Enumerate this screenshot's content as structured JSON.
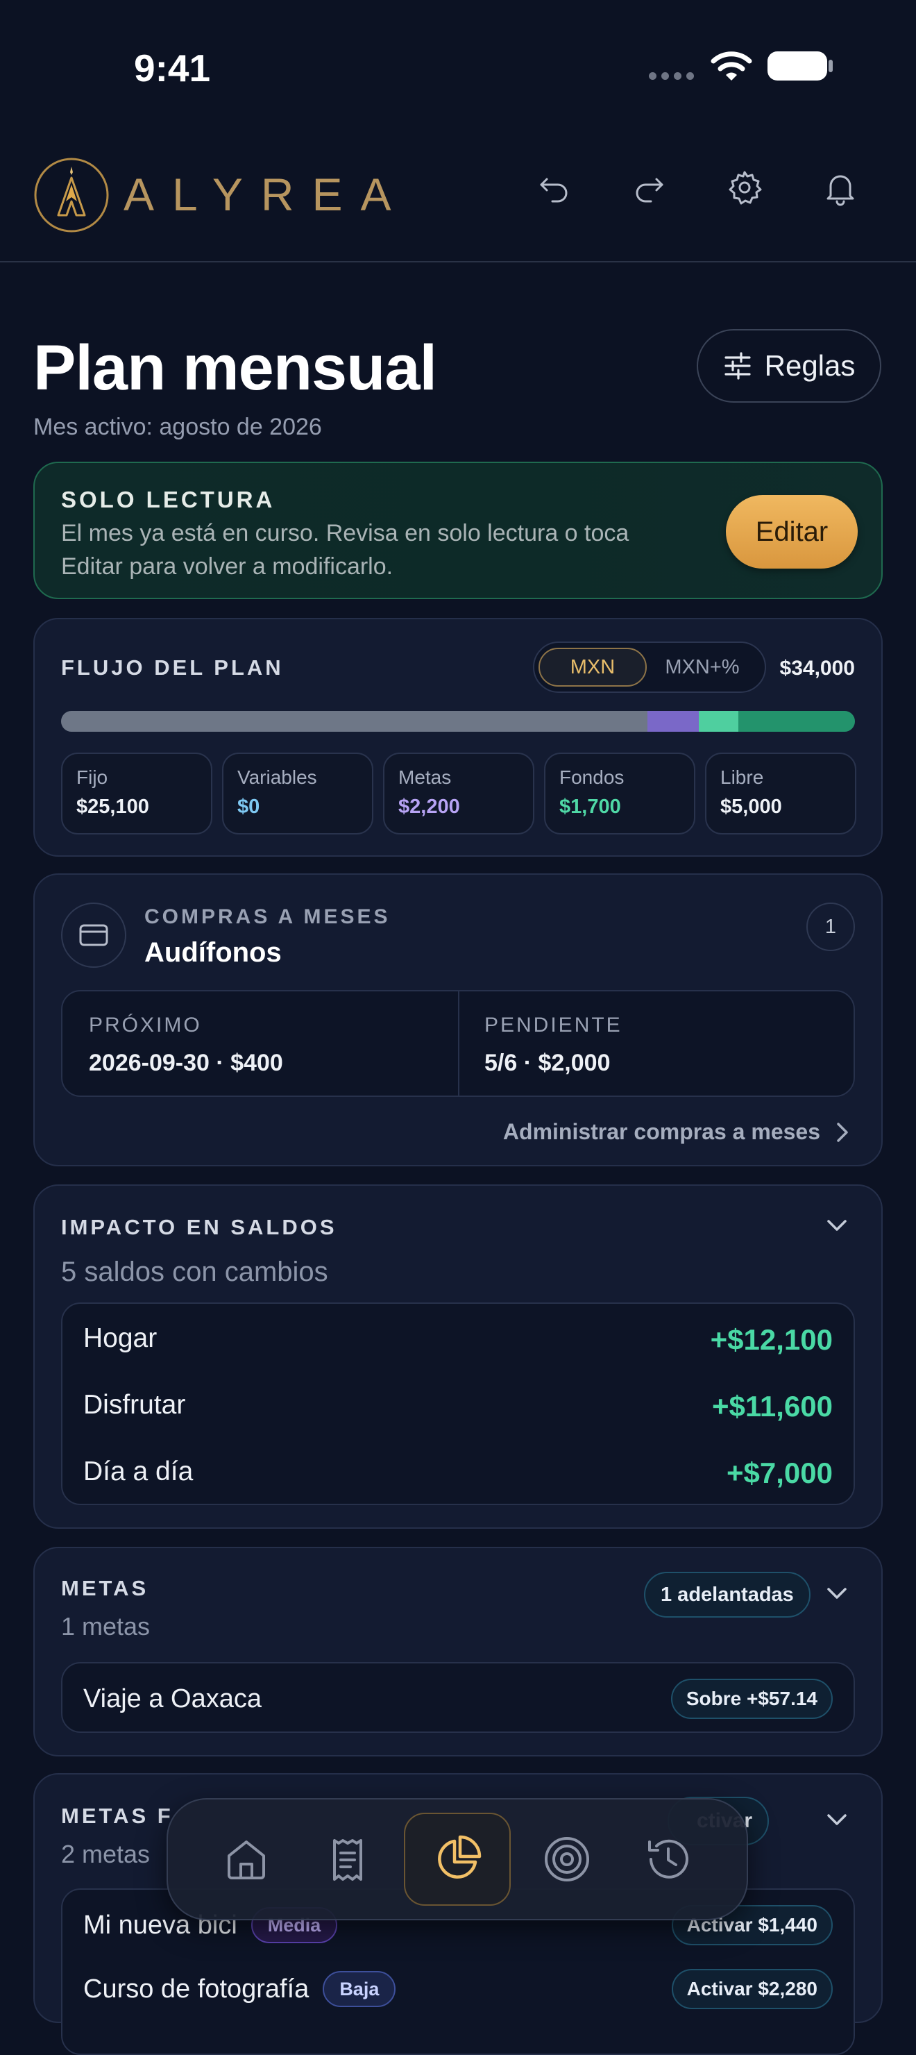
{
  "status_bar": {
    "time": "9:41"
  },
  "header": {
    "brand": "ALYREA",
    "icons": [
      "undo-icon",
      "redo-icon",
      "gear-icon",
      "bell-icon"
    ]
  },
  "page": {
    "title": "Plan mensual",
    "subtitle": "Mes activo: agosto de 2026",
    "rules_button": "Reglas"
  },
  "readonly": {
    "title": "SOLO LECTURA",
    "text_line1": "El mes ya está en curso. Revisa en solo lectura o toca",
    "text_line2": "Editar para volver a modificarlo.",
    "edit_button": "Editar"
  },
  "flow": {
    "title": "FLUJO DEL PLAN",
    "toggle": [
      "MXN",
      "MXN+%"
    ],
    "toggle_selected": "MXN",
    "total": "$34,000",
    "segments": [
      {
        "label": "Fijo",
        "value": "$25,100",
        "amount": 25100,
        "color": "#6e7787",
        "value_color": "#eef1f6"
      },
      {
        "label": "Variables",
        "value": "$0",
        "amount": 0,
        "color": "#6bb8e8",
        "value_color": "#7ec8f2"
      },
      {
        "label": "Metas",
        "value": "$2,200",
        "amount": 2200,
        "color": "#7a68c8",
        "value_color": "#b7a3f4"
      },
      {
        "label": "Fondos",
        "value": "$1,700",
        "amount": 1700,
        "color": "#4fcf9f",
        "value_color": "#4fd8a6"
      },
      {
        "label": "Libre",
        "value": "$5,000",
        "amount": 5000,
        "color": "#23936c",
        "value_color": "#eef1f6"
      }
    ]
  },
  "installments": {
    "label": "COMPRAS A MESES",
    "item": "Audífonos",
    "count": "1",
    "next_label": "PRÓXIMO",
    "next_value": "2026-09-30 · $400",
    "pending_label": "PENDIENTE",
    "pending_value": "5/6 · $2,000",
    "manage_link": "Administrar compras a meses"
  },
  "impact": {
    "title": "IMPACTO EN SALDOS",
    "subtitle": "5 saldos con cambios",
    "rows": [
      {
        "name": "Hogar",
        "value": "+$12,100"
      },
      {
        "name": "Disfrutar",
        "value": "+$11,600"
      },
      {
        "name": "Día a día",
        "value": "+$7,000"
      }
    ]
  },
  "goals": {
    "title": "METAS",
    "subtitle": "1 metas",
    "badge": "1 adelantadas",
    "items": [
      {
        "name": "Viaje a Oaxaca",
        "status": "Sobre +$57.14"
      }
    ]
  },
  "future_goals": {
    "title": "METAS F",
    "subtitle": "2 metas",
    "badge": "ctivar",
    "items": [
      {
        "name": "Mi nueva bici",
        "priority": "Media",
        "action": "Activar $1,440"
      },
      {
        "name": "Curso de fotografía",
        "priority": "Baja",
        "action": "Activar $2,280"
      }
    ]
  },
  "tab_bar": {
    "items": [
      "home-icon",
      "receipt-icon",
      "pie-chart-icon",
      "target-icon",
      "history-icon"
    ],
    "active": "pie-chart-icon"
  }
}
